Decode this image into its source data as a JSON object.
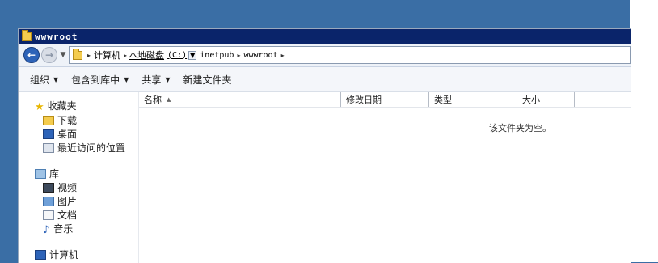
{
  "window": {
    "title": "wwwroot"
  },
  "addressbar": {
    "crumbs": [
      "计算机",
      "本地磁盘",
      "(C:)",
      "inetpub",
      "wwwroot"
    ]
  },
  "toolbar": {
    "organize": "组织",
    "include_in_library": "包含到库中",
    "share": "共享",
    "new_folder": "新建文件夹"
  },
  "nav": {
    "favorites": "收藏夹",
    "downloads": "下载",
    "desktop": "桌面",
    "recent": "最近访问的位置",
    "libraries": "库",
    "videos": "视频",
    "pictures": "图片",
    "documents": "文档",
    "music": "音乐",
    "computer": "计算机"
  },
  "columns": {
    "name": "名称",
    "date_modified": "修改日期",
    "type": "类型",
    "size": "大小"
  },
  "empty_message": "该文件夹为空。"
}
